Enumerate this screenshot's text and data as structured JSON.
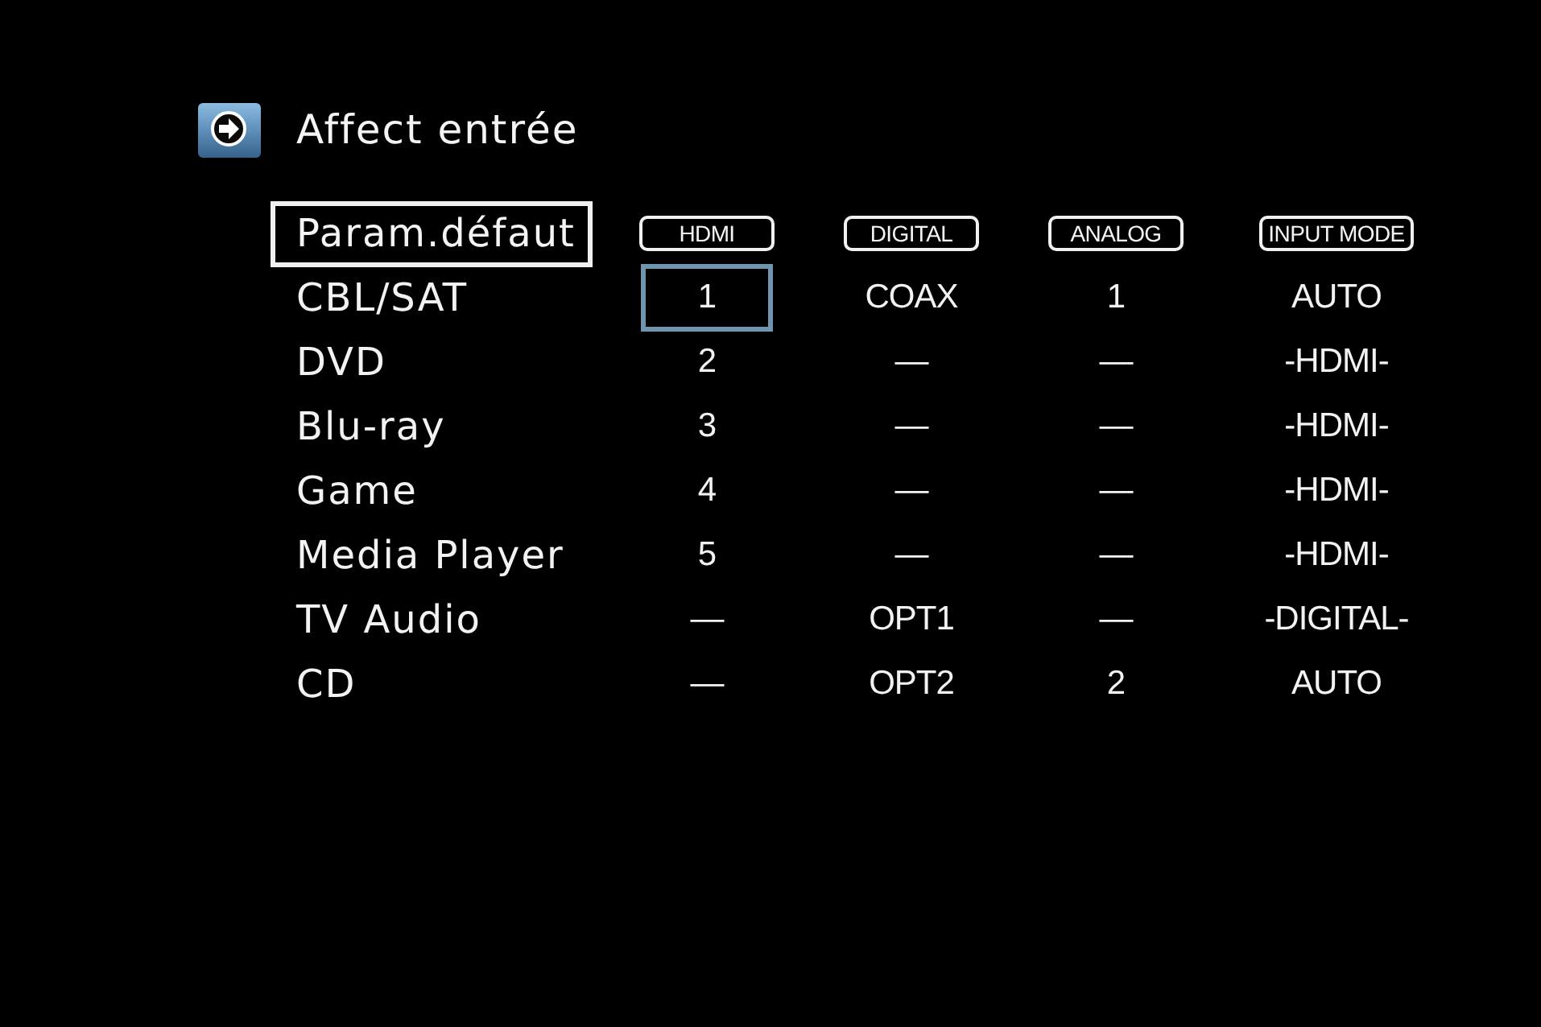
{
  "title": {
    "text": "Affect entrée"
  },
  "table": {
    "default_button": {
      "label": "Param.défaut"
    },
    "columns": [
      "HDMI",
      "DIGITAL",
      "ANALOG",
      "INPUT MODE"
    ],
    "rows": [
      {
        "source": "CBL/SAT",
        "cells": [
          {
            "text": "1",
            "selected": true
          },
          {
            "text": "COAX",
            "selected": false
          },
          {
            "text": "1",
            "selected": false
          },
          {
            "text": "AUTO",
            "selected": false
          }
        ]
      },
      {
        "source": "DVD",
        "cells": [
          {
            "text": "2",
            "selected": false
          },
          {
            "text": "—",
            "selected": false
          },
          {
            "text": "—",
            "selected": false
          },
          {
            "text": "-HDMI-",
            "selected": false
          }
        ]
      },
      {
        "source": "Blu-ray",
        "cells": [
          {
            "text": "3",
            "selected": false
          },
          {
            "text": "—",
            "selected": false
          },
          {
            "text": "—",
            "selected": false
          },
          {
            "text": "-HDMI-",
            "selected": false
          }
        ]
      },
      {
        "source": "Game",
        "cells": [
          {
            "text": "4",
            "selected": false
          },
          {
            "text": "—",
            "selected": false
          },
          {
            "text": "—",
            "selected": false
          },
          {
            "text": "-HDMI-",
            "selected": false
          }
        ]
      },
      {
        "source": "Media Player",
        "cells": [
          {
            "text": "5",
            "selected": false
          },
          {
            "text": "—",
            "selected": false
          },
          {
            "text": "—",
            "selected": false
          },
          {
            "text": "-HDMI-",
            "selected": false
          }
        ]
      },
      {
        "source": "TV Audio",
        "cells": [
          {
            "text": "—",
            "selected": false
          },
          {
            "text": "OPT1",
            "selected": false
          },
          {
            "text": "—",
            "selected": false
          },
          {
            "text": "-DIGITAL-",
            "selected": false
          }
        ]
      },
      {
        "source": "CD",
        "cells": [
          {
            "text": "—",
            "selected": false
          },
          {
            "text": "OPT2",
            "selected": false
          },
          {
            "text": "2",
            "selected": false
          },
          {
            "text": "AUTO",
            "selected": false
          }
        ]
      }
    ]
  }
}
